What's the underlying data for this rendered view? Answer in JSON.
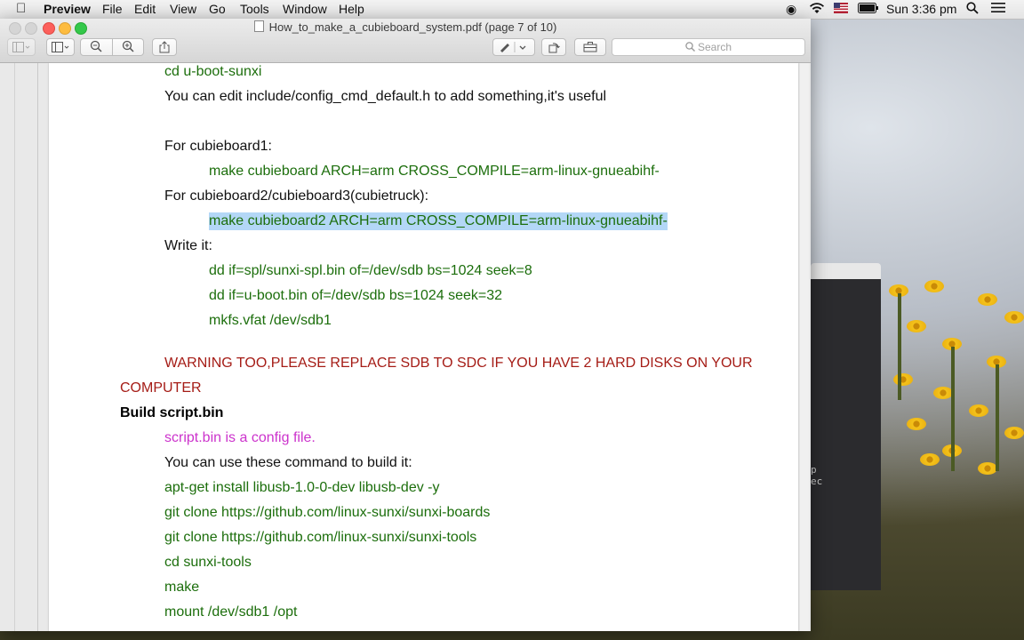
{
  "menubar": {
    "app_name": "Preview",
    "menus": [
      "File",
      "Edit",
      "View",
      "Go",
      "Tools",
      "Window",
      "Help"
    ],
    "clock": "Sun 3:36 pm"
  },
  "window": {
    "title": "How_to_make_a_cubieboard_system.pdf (page 7 of 10)",
    "search_placeholder": "Search"
  },
  "document": {
    "lines": [
      {
        "text": "cd u-boot-sunxi",
        "style": "green"
      },
      {
        "text": "You can edit include/config_cmd_default.h to add something,it's useful",
        "style": "black"
      },
      {
        "text": "For cubieboard1:",
        "style": "black"
      },
      {
        "text": "make cubieboard ARCH=arm CROSS_COMPILE=arm-linux-gnueabihf-",
        "style": "green"
      },
      {
        "text": "For cubieboard2/cubieboard3(cubietruck):",
        "style": "black"
      },
      {
        "text": "make cubieboard2 ARCH=arm CROSS_COMPILE=arm-linux-gnueabihf-",
        "style": "green-highlight"
      },
      {
        "text": "Write it:",
        "style": "black"
      },
      {
        "text": "dd if=spl/sunxi-spl.bin of=/dev/sdb bs=1024 seek=8",
        "style": "green"
      },
      {
        "text": "dd if=u-boot.bin of=/dev/sdb bs=1024 seek=32",
        "style": "green"
      },
      {
        "text": "mkfs.vfat /dev/sdb1",
        "style": "green"
      },
      {
        "text": "WARNING TOO,PLEASE REPLACE SDB TO SDC IF YOU HAVE 2 HARD DISKS ON YOUR",
        "style": "red"
      },
      {
        "text": "COMPUTER",
        "style": "red"
      },
      {
        "text": "Build script.bin",
        "style": "bold"
      },
      {
        "text": "script.bin is a config file.",
        "style": "magenta"
      },
      {
        "text": "You can use these command to build it:",
        "style": "black"
      },
      {
        "text": "apt-get install libusb-1.0-0-dev libusb-dev -y",
        "style": "green"
      },
      {
        "text": "git clone https://github.com/linux-sunxi/sunxi-boards",
        "style": "green"
      },
      {
        "text": "git clone https://github.com/linux-sunxi/sunxi-tools",
        "style": "green"
      },
      {
        "text": "cd sunxi-tools",
        "style": "green"
      },
      {
        "text": "make",
        "style": "green"
      },
      {
        "text": "mount /dev/sdb1 /opt",
        "style": "green"
      }
    ]
  },
  "background_window": {
    "fragment_1": "p",
    "fragment_2": "ec"
  },
  "colors": {
    "code_green": "#1c6e0c",
    "warning_red": "#a51c16",
    "note_magenta": "#cc33cc",
    "selection": "#b3d7f6"
  }
}
